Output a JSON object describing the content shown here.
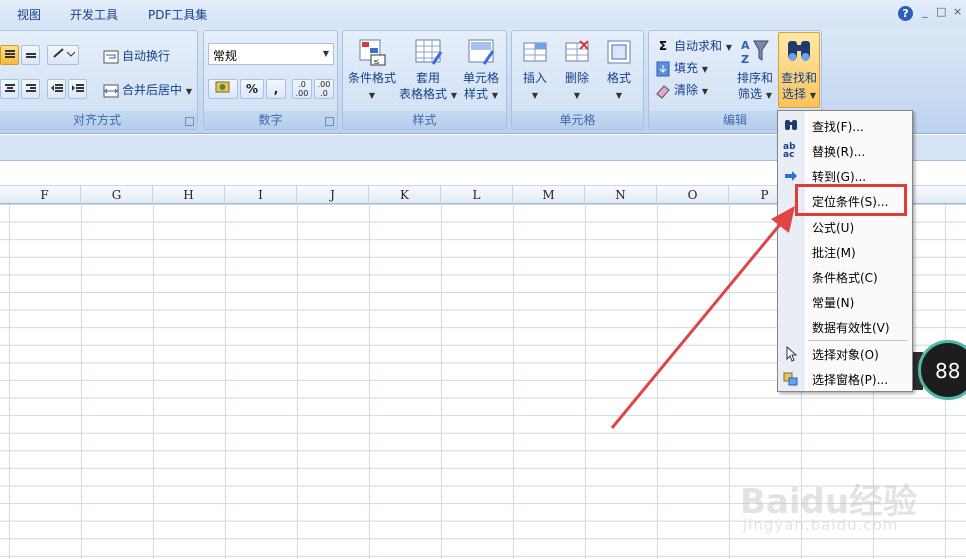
{
  "tabs": [
    "视图",
    "开发工具",
    "PDF工具集"
  ],
  "window_controls": [
    "?",
    "_",
    "□",
    "×"
  ],
  "ribbon": {
    "alignment": {
      "label": "对齐方式",
      "wrap_text": "自动换行",
      "merge_center": "合并后居中"
    },
    "number": {
      "label": "数字",
      "format_value": "常规",
      "percent": "%",
      "comma": ",",
      "increase_decimal": ".0\n.00",
      "decrease_decimal": ".00\n.0"
    },
    "styles": {
      "label": "样式",
      "conditional_format": "条件格式",
      "table_format_1": "套用",
      "table_format_2": "表格格式",
      "cell_style_1": "单元格",
      "cell_style_2": "样式"
    },
    "cells": {
      "label": "单元格",
      "insert": "插入",
      "delete": "删除",
      "format": "格式"
    },
    "editing": {
      "label": "编辑",
      "autosum": "自动求和",
      "fill": "填充",
      "clear": "清除",
      "sort_filter_1": "排序和",
      "sort_filter_2": "筛选",
      "find_select_1": "查找和",
      "find_select_2": "选择"
    }
  },
  "columns": [
    "F",
    "G",
    "H",
    "I",
    "J",
    "K",
    "L",
    "M",
    "N",
    "O",
    "P"
  ],
  "menu": {
    "items": [
      {
        "label": "查找(F)...",
        "icon": "binoculars-icon"
      },
      {
        "label": "替换(R)...",
        "icon": "replace-icon"
      },
      {
        "label": "转到(G)...",
        "icon": "arrow-right-icon"
      },
      {
        "label": "定位条件(S)...",
        "icon": ""
      },
      {
        "label": "公式(U)",
        "icon": ""
      },
      {
        "label": "批注(M)",
        "icon": ""
      },
      {
        "label": "条件格式(C)",
        "icon": ""
      },
      {
        "label": "常量(N)",
        "icon": ""
      },
      {
        "label": "数据有效性(V)",
        "icon": ""
      },
      {
        "label": "选择对象(O)",
        "icon": "cursor-icon"
      },
      {
        "label": "选择窗格(P)...",
        "icon": "selection-pane-icon"
      }
    ]
  },
  "speed_widget": {
    "value": "88"
  },
  "watermark": {
    "text": "Baidu经验",
    "url": "jingyan.baidu.com"
  },
  "colors": {
    "highlight": "#e53a3a",
    "arrow": "#e04545",
    "ribbon_text": "#15428b"
  }
}
